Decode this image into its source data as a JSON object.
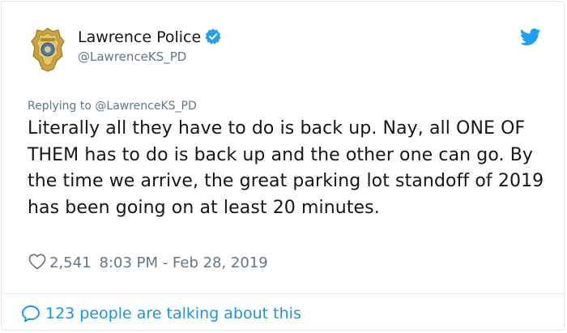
{
  "author": {
    "display_name": "Lawrence Police",
    "handle": "@LawrenceKS_PD",
    "verified": true,
    "avatar_icon": "police-badge-icon"
  },
  "platform_icon": "twitter-bird-icon",
  "reply": {
    "prefix": "Replying to",
    "to_handle": "@LawrenceKS_PD"
  },
  "tweet": {
    "text": "Literally all they have to do is back up. Nay, all ONE OF THEM has to do is back up and the other one can go. By the time we arrive, the great parking lot standoff of 2019 has been going on at least 20 minutes.",
    "likes": "2,541",
    "timestamp": "8:03 PM - Feb 28, 2019"
  },
  "footer": {
    "talking_label": "123 people are talking about this"
  },
  "colors": {
    "accent": "#1da1f2",
    "link": "#1b95e0",
    "text": "#14171a",
    "muted": "#657786",
    "border": "#e1e8ed",
    "badge_gold": "#c9a441"
  }
}
